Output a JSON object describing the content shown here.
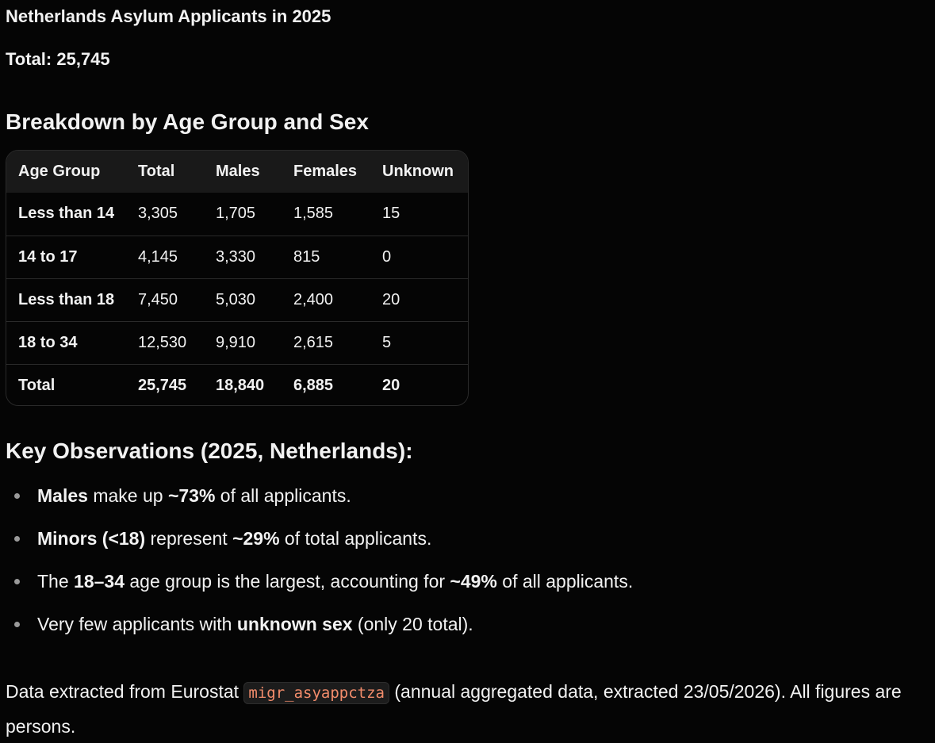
{
  "title": "Netherlands Asylum Applicants in 2025",
  "total_line": "Total: 25,745",
  "breakdown_heading": "Breakdown by Age Group and Sex",
  "table": {
    "headers": [
      "Age Group",
      "Total",
      "Males",
      "Females",
      "Unknown"
    ],
    "rows": [
      [
        "Less than 14",
        "3,305",
        "1,705",
        "1,585",
        "15"
      ],
      [
        "14 to 17",
        "4,145",
        "3,330",
        "815",
        "0"
      ],
      [
        "Less than 18",
        "7,450",
        "5,030",
        "2,400",
        "20"
      ],
      [
        "18 to 34",
        "12,530",
        "9,910",
        "2,615",
        "5"
      ],
      [
        "Total",
        "25,745",
        "18,840",
        "6,885",
        "20"
      ]
    ]
  },
  "observations_heading": "Key Observations (2025, Netherlands):",
  "observations": [
    {
      "b1": "Males",
      "t1": " make up ",
      "b2": "~73%",
      "t2": " of all applicants."
    },
    {
      "b1": "Minors (<18)",
      "t1": " represent ",
      "b2": "~29%",
      "t2": " of total applicants."
    },
    {
      "t0": "The ",
      "b1": "18–34",
      "t1": " age group is the largest, accounting for ",
      "b2": "~49%",
      "t2": " of all applicants."
    },
    {
      "t0": "Very few applicants with ",
      "b1": "unknown sex",
      "t1": " (only 20 total)."
    }
  ],
  "footer": {
    "before": "Data extracted from Eurostat ",
    "code": "migr_asyappctza",
    "after": " (annual aggregated data, extracted 23/05/2026). All figures are persons."
  },
  "colors": {
    "background": "#050505",
    "text": "#f2f2f2",
    "code_text": "#f28c6b",
    "table_header_bg": "#191919",
    "border": "#2a2a2a"
  }
}
